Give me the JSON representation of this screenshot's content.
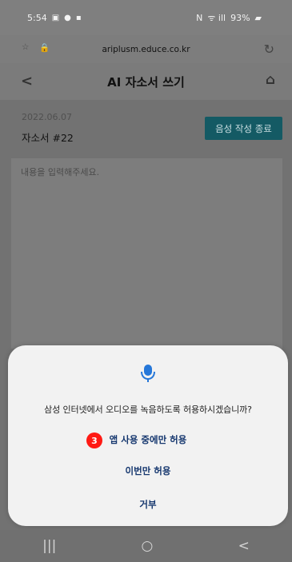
{
  "status": {
    "time": "5:54",
    "icons_left": [
      "gallery-icon",
      "message-icon",
      "app-icon"
    ],
    "network": "N",
    "signal_text": "ᯤ ill",
    "battery": "93%"
  },
  "browser": {
    "url": "ariplusm.educe.co.kr"
  },
  "app": {
    "back": "<",
    "title": "AI 자소서 쓰기"
  },
  "document": {
    "date": "2022.06.07",
    "title": "자소서 #22",
    "voice_button": "음성 작성 종료",
    "placeholder": "내용을 입력해주세요."
  },
  "dialog": {
    "prompt": "삼성 인터넷에서 오디오를 녹음하도록 허용하시겠습니까?",
    "badge": "3",
    "options": [
      "앱 사용 중에만 허용",
      "이번만 허용",
      "거부"
    ]
  },
  "navigation": {
    "buttons": [
      "|||",
      "○",
      "<"
    ]
  },
  "colors": {
    "dialog_text": "#14366e",
    "badge": "#ff1a14",
    "voice_button": "#145a64",
    "mic": "#2577d9"
  }
}
